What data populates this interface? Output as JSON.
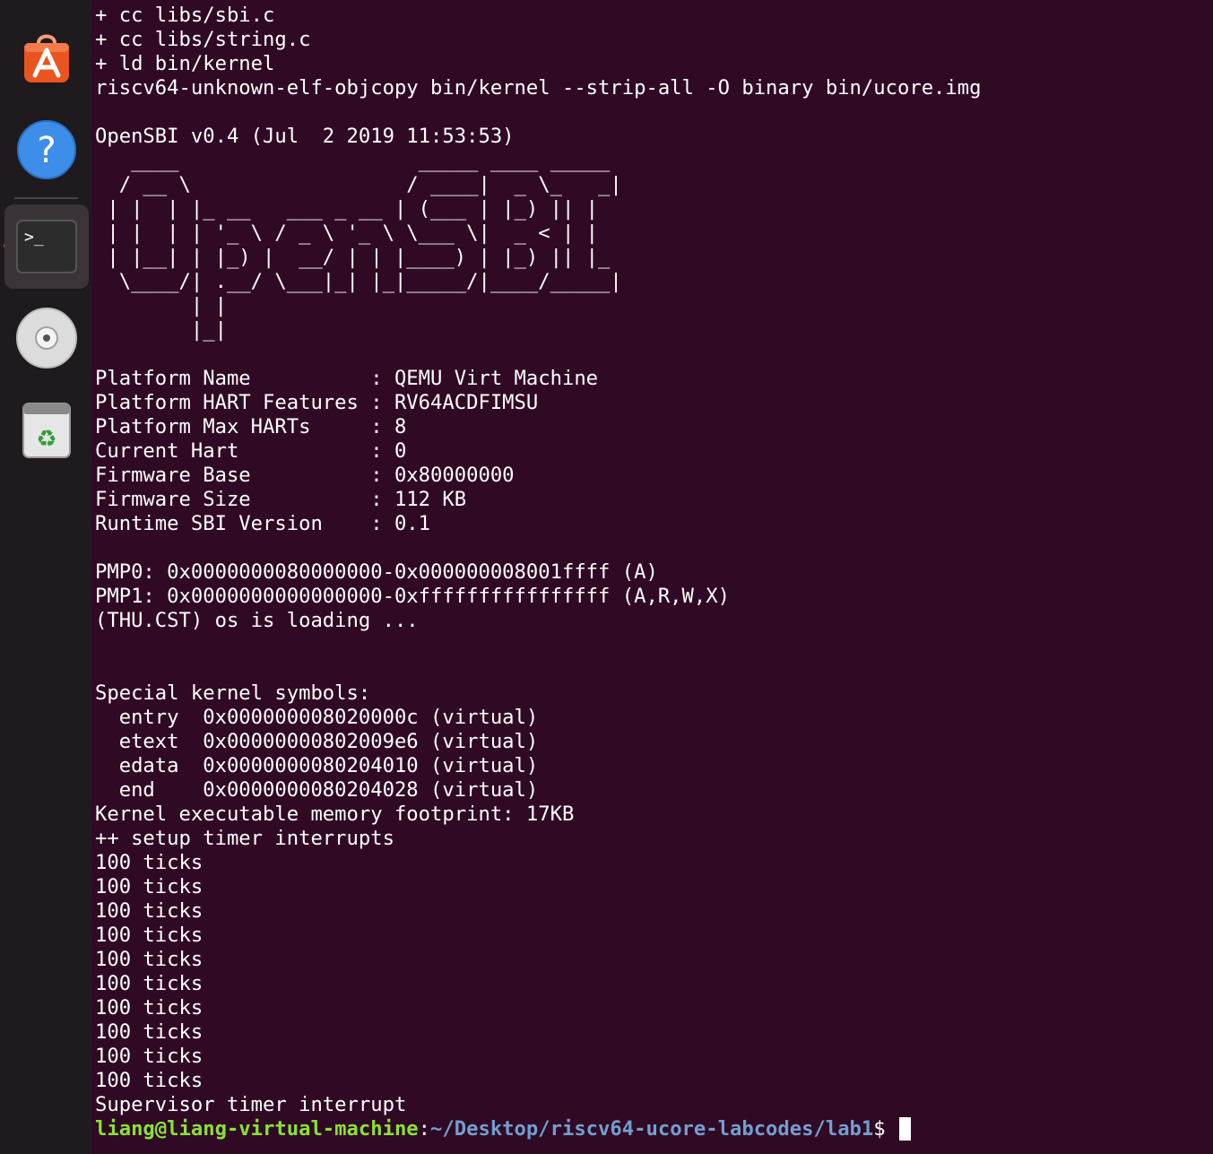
{
  "dock": {
    "items": [
      {
        "name": "ubuntu-software-icon"
      },
      {
        "name": "help-icon",
        "glyph": "?"
      },
      {
        "name": "terminal-icon",
        "glyph": ">_"
      },
      {
        "name": "dvd-drive-icon"
      },
      {
        "name": "trash-icon",
        "glyph": "♻"
      }
    ],
    "accent": "#e95420"
  },
  "terminal": {
    "background": "#300a24",
    "lines": [
      "+ cc libs/sbi.c",
      "+ cc libs/string.c",
      "+ ld bin/kernel",
      "riscv64-unknown-elf-objcopy bin/kernel --strip-all -O binary bin/ucore.img",
      "",
      "OpenSBI v0.4 (Jul  2 2019 11:53:53)",
      "   ____                    _____ ____ _____",
      "  / __ \\                  / ____|  _ \\_   _|",
      " | |  | |_ __   ___ _ __ | (___ | |_) || |",
      " | |  | | '_ \\ / _ \\ '_ \\ \\___ \\|  _ < | |",
      " | |__| | |_) |  __/ | | |____) | |_) || |_",
      "  \\____/| .__/ \\___|_| |_|_____/|____/_____|",
      "        | |",
      "        |_|",
      "",
      "Platform Name          : QEMU Virt Machine",
      "Platform HART Features : RV64ACDFIMSU",
      "Platform Max HARTs     : 8",
      "Current Hart           : 0",
      "Firmware Base          : 0x80000000",
      "Firmware Size          : 112 KB",
      "Runtime SBI Version    : 0.1",
      "",
      "PMP0: 0x0000000080000000-0x000000008001ffff (A)",
      "PMP1: 0x0000000000000000-0xffffffffffffffff (A,R,W,X)",
      "(THU.CST) os is loading ...",
      "",
      "",
      "Special kernel symbols:",
      "  entry  0x000000008020000c (virtual)",
      "  etext  0x00000000802009e6 (virtual)",
      "  edata  0x0000000080204010 (virtual)",
      "  end    0x0000000080204028 (virtual)",
      "Kernel executable memory footprint: 17KB",
      "++ setup timer interrupts",
      "100 ticks",
      "100 ticks",
      "100 ticks",
      "100 ticks",
      "100 ticks",
      "100 ticks",
      "100 ticks",
      "100 ticks",
      "100 ticks",
      "100 ticks",
      "Supervisor timer interrupt"
    ],
    "prompt": {
      "user_host": "liang@liang-virtual-machine",
      "colon": ":",
      "path": "~/Desktop/riscv64-ucore-labcodes/lab1",
      "dollar": "$ ",
      "user_color": "#8ae234",
      "path_color": "#729fcf"
    }
  }
}
